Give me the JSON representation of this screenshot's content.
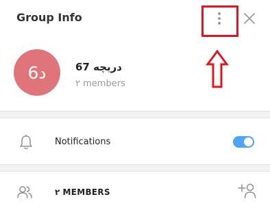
{
  "header": {
    "title": "Group Info",
    "menu_icon": "vertical-ellipsis-icon",
    "close_icon": "close-icon"
  },
  "profile": {
    "avatar_text": "د6",
    "avatar_color": "#e0747b",
    "group_name": "دریچه 67",
    "member_count": "۲ members"
  },
  "notifications": {
    "icon": "bell-icon",
    "label": "Notifications",
    "enabled": true,
    "toggle_color": "#4ea4f6"
  },
  "members": {
    "icon": "members-icon",
    "label": "۲ MEMBERS",
    "add_icon": "add-member-icon"
  },
  "annotation": {
    "color": "#e3141e"
  }
}
